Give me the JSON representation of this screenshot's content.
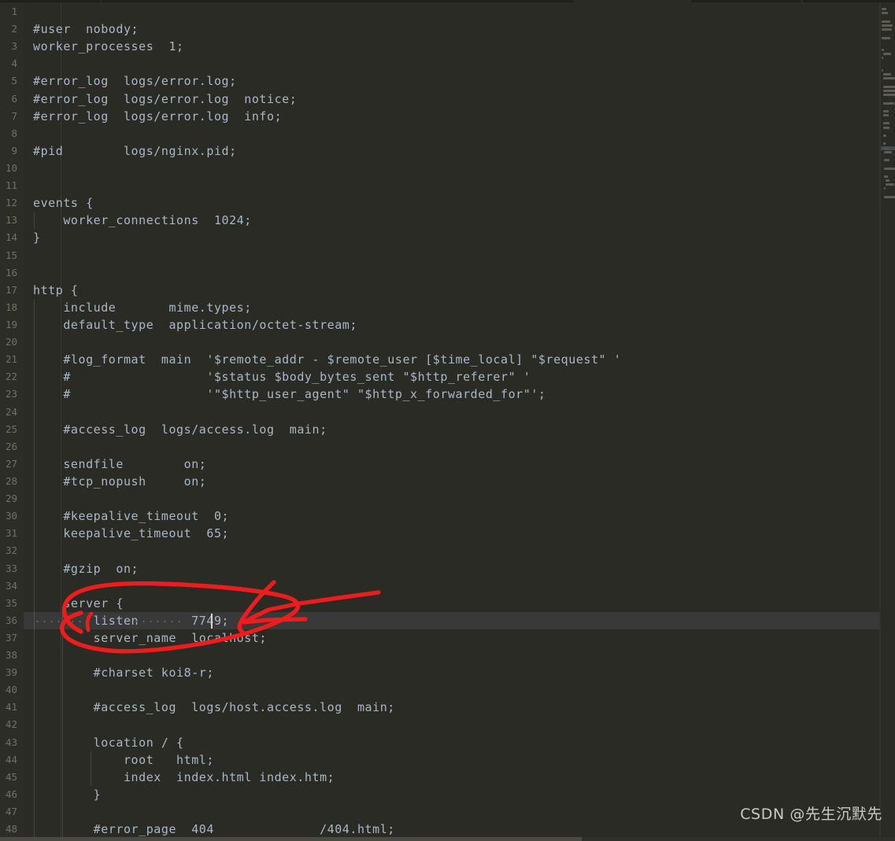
{
  "app": {
    "kind": "code-editor",
    "theme": "darcula",
    "background_color": "#2b2b26",
    "gutter_color": "#2d2d28",
    "text_color": "#a9b7c6",
    "line_number_color": "#717165",
    "current_line_color": "#393939",
    "annotation_color": "#ee1c1c"
  },
  "editor": {
    "file_kind": "nginx.conf",
    "current_line": 36,
    "caret_after_text": "7749",
    "first_visible_line": 1,
    "last_visible_line": 48,
    "line_height_px": 22.12,
    "font_size_px": 15,
    "lines": [
      {
        "n": 1,
        "text": ""
      },
      {
        "n": 2,
        "text": "#user  nobody;"
      },
      {
        "n": 3,
        "text": "worker_processes  1;"
      },
      {
        "n": 4,
        "text": ""
      },
      {
        "n": 5,
        "text": "#error_log  logs/error.log;"
      },
      {
        "n": 6,
        "text": "#error_log  logs/error.log  notice;"
      },
      {
        "n": 7,
        "text": "#error_log  logs/error.log  info;"
      },
      {
        "n": 8,
        "text": ""
      },
      {
        "n": 9,
        "text": "#pid        logs/nginx.pid;"
      },
      {
        "n": 10,
        "text": ""
      },
      {
        "n": 11,
        "text": ""
      },
      {
        "n": 12,
        "text": "events {"
      },
      {
        "n": 13,
        "text": "    worker_connections  1024;"
      },
      {
        "n": 14,
        "text": "}"
      },
      {
        "n": 15,
        "text": ""
      },
      {
        "n": 16,
        "text": ""
      },
      {
        "n": 17,
        "text": "http {"
      },
      {
        "n": 18,
        "text": "    include       mime.types;"
      },
      {
        "n": 19,
        "text": "    default_type  application/octet-stream;"
      },
      {
        "n": 20,
        "text": ""
      },
      {
        "n": 21,
        "text": "    #log_format  main  '$remote_addr - $remote_user [$time_local] \"$request\" '"
      },
      {
        "n": 22,
        "text": "    #                  '$status $body_bytes_sent \"$http_referer\" '"
      },
      {
        "n": 23,
        "text": "    #                  '\"$http_user_agent\" \"$http_x_forwarded_for\"';"
      },
      {
        "n": 24,
        "text": ""
      },
      {
        "n": 25,
        "text": "    #access_log  logs/access.log  main;"
      },
      {
        "n": 26,
        "text": ""
      },
      {
        "n": 27,
        "text": "    sendfile        on;"
      },
      {
        "n": 28,
        "text": "    #tcp_nopush     on;"
      },
      {
        "n": 29,
        "text": ""
      },
      {
        "n": 30,
        "text": "    #keepalive_timeout  0;"
      },
      {
        "n": 31,
        "text": "    keepalive_timeout  65;"
      },
      {
        "n": 32,
        "text": ""
      },
      {
        "n": 33,
        "text": "    #gzip  on;"
      },
      {
        "n": 34,
        "text": ""
      },
      {
        "n": 35,
        "text": "    server {"
      },
      {
        "n": 36,
        "text": "        listen       7749;"
      },
      {
        "n": 37,
        "text": "        server_name  localhost;"
      },
      {
        "n": 38,
        "text": ""
      },
      {
        "n": 39,
        "text": "        #charset koi8-r;"
      },
      {
        "n": 40,
        "text": ""
      },
      {
        "n": 41,
        "text": "        #access_log  logs/host.access.log  main;"
      },
      {
        "n": 42,
        "text": ""
      },
      {
        "n": 43,
        "text": "        location / {"
      },
      {
        "n": 44,
        "text": "            root   html;"
      },
      {
        "n": 45,
        "text": "            index  index.html index.htm;"
      },
      {
        "n": 46,
        "text": "        }"
      },
      {
        "n": 47,
        "text": ""
      },
      {
        "n": 48,
        "text": "        #error_page  404              /404.html;"
      }
    ]
  },
  "annotation": {
    "kind": "hand-drawn-red-ink",
    "shapes": [
      "ellipse-around-listen-port",
      "arrow-pointing-to-ellipse"
    ],
    "target_lines": [
      35,
      36,
      37
    ],
    "emphasized_value": "7749",
    "color": "#ee1c1c"
  },
  "minimap": {
    "visible": true,
    "highlight_row": 36
  },
  "watermark": {
    "text": "CSDN @先生沉默先"
  },
  "scrollbar": {
    "horizontal_thumb_fraction": 0.65
  }
}
